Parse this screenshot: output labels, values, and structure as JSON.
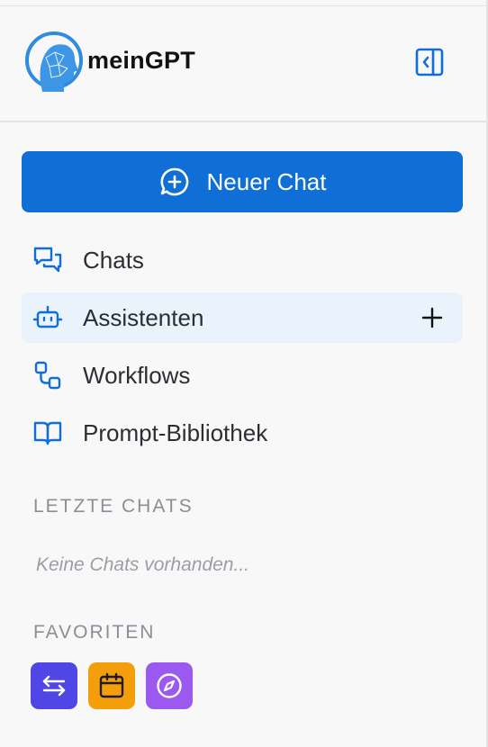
{
  "brand": {
    "name": "meinGPT"
  },
  "sidebar": {
    "new_chat_label": "Neuer Chat",
    "nav": [
      {
        "label": "Chats",
        "icon": "chat-bubbles-icon"
      },
      {
        "label": "Assistenten",
        "icon": "bot-icon",
        "active": true
      },
      {
        "label": "Workflows",
        "icon": "workflow-icon"
      },
      {
        "label": "Prompt-Bibliothek",
        "icon": "book-open-icon"
      }
    ],
    "recent": {
      "title": "LETZTE CHATS",
      "empty": "Keine Chats vorhanden..."
    },
    "favorites": {
      "title": "FAVORITEN",
      "items": [
        {
          "icon": "arrows-left-right-icon",
          "color": "#5046e5"
        },
        {
          "icon": "calendar-icon",
          "color": "#f59e0b"
        },
        {
          "icon": "compass-icon",
          "color": "#9b59f0"
        }
      ]
    }
  },
  "colors": {
    "accent": "#0f6fd6",
    "active_bg": "#eaf2fb"
  }
}
